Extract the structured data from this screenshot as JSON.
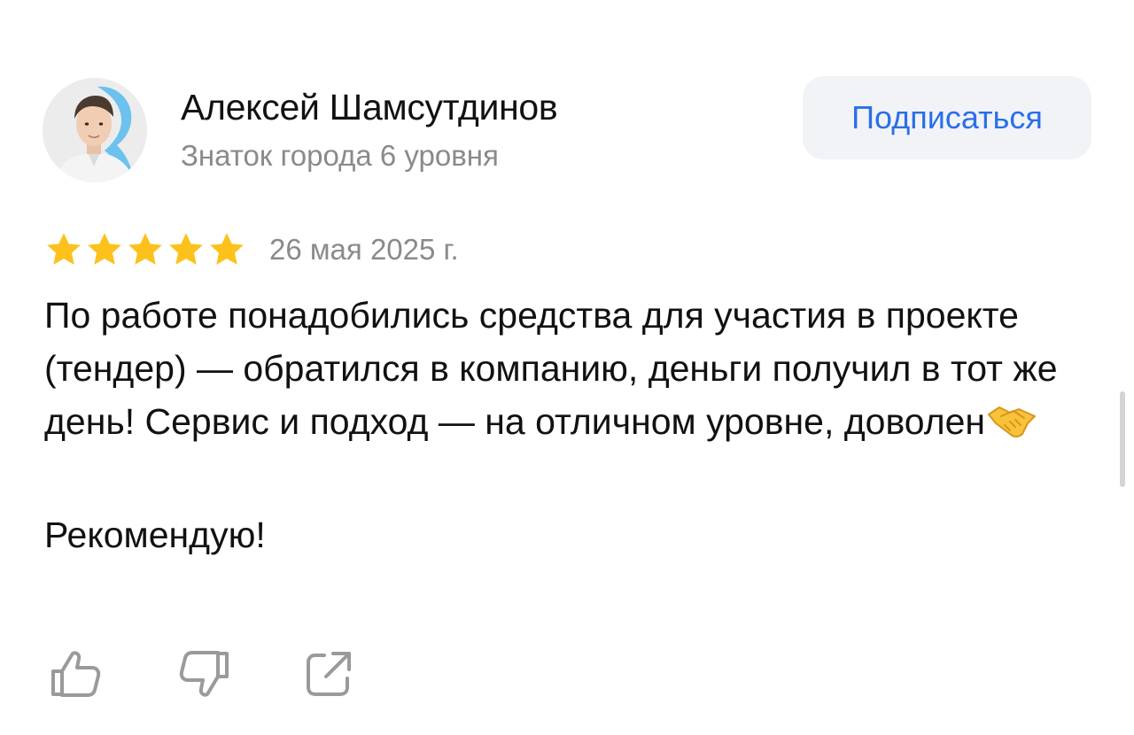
{
  "author": {
    "name": "Алексей Шамсутдинов",
    "level": "Знаток города 6 уровня",
    "avatar_icon": "person-photo-avatar"
  },
  "subscribe_label": "Подписаться",
  "review": {
    "rating": 5,
    "rating_max": 5,
    "date": "26 мая 2025 г.",
    "text_paragraph_1": "По работе понадобились средства для участия в проекте (тендер) — обратился в компанию, деньги получил в тот же день! Сервис и подход — на отличном уровне, доволен",
    "text_emoji": "handshake-icon",
    "text_paragraph_2": "Рекомендую!"
  },
  "actions": {
    "like_icon": "thumbs-up-icon",
    "dislike_icon": "thumbs-down-icon",
    "share_icon": "share-icon"
  },
  "colors": {
    "accent": "#2a6fe8",
    "star": "#fcc21b",
    "muted_text": "#8a8a8a",
    "button_bg": "#f1f3f7",
    "icon_gray": "#9a9a9a"
  }
}
